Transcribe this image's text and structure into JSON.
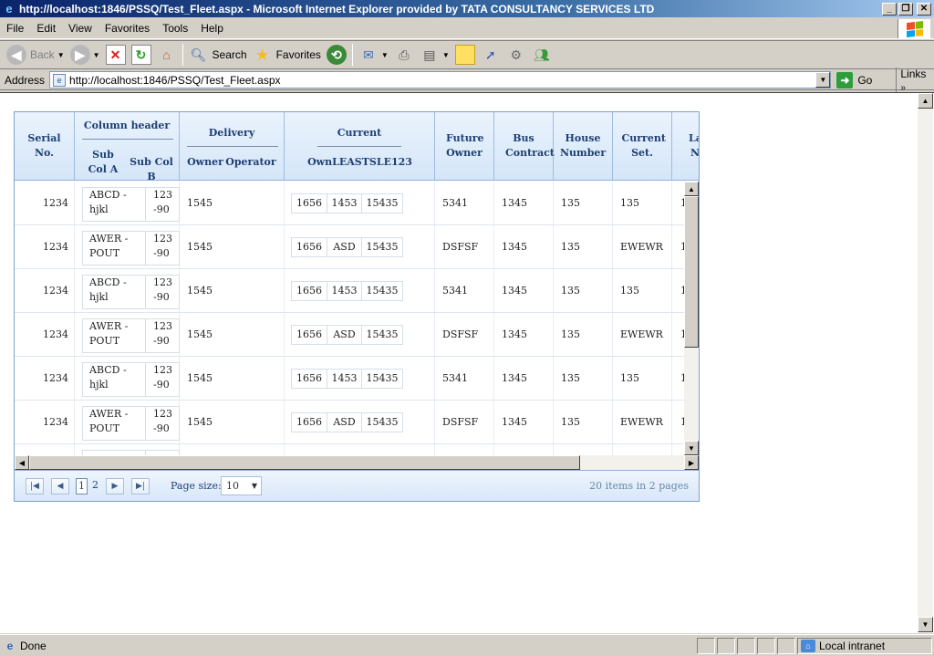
{
  "window": {
    "title": "http://localhost:1846/PSSQ/Test_Fleet.aspx - Microsoft Internet Explorer provided by TATA CONSULTANCY SERVICES LTD",
    "controls": [
      "minimize",
      "restore",
      "close"
    ]
  },
  "menu": [
    "File",
    "Edit",
    "View",
    "Favorites",
    "Tools",
    "Help"
  ],
  "toolbar": {
    "back": "Back",
    "search": "Search",
    "favorites": "Favorites"
  },
  "address": {
    "label": "Address",
    "url": "http://localhost:1846/PSSQ/Test_Fleet.aspx",
    "go": "Go",
    "links": "Links"
  },
  "grid": {
    "headers": {
      "serial": "Serial No.",
      "colgroup": "Column header",
      "subA": "Sub Col A",
      "subB": "Sub Col B",
      "delivery": "Delivery",
      "owner": "Owner",
      "operator": "Operator",
      "current": "Current",
      "currentSub": "OwnLEASTSLE123",
      "futureOwner": "Future Owner",
      "busContract": "Bus Contract",
      "houseNumber": "House Number",
      "currentSet": "Current Set.",
      "partial": "La N"
    },
    "rows": [
      {
        "serial": "1234",
        "a": "ABCD - hjkl",
        "b": "123-90",
        "owner": "1545",
        "c1": "1656",
        "c2": "1453",
        "c3": "15435",
        "future": "5341",
        "bus": "1345",
        "house": "135",
        "set": "135",
        "last": "1"
      },
      {
        "serial": "1234",
        "a": "AWER - POUT",
        "b": "123-90",
        "owner": "1545",
        "c1": "1656",
        "c2": "ASD",
        "c3": "15435",
        "future": "DSFSF",
        "bus": "1345",
        "house": "135",
        "set": "EWEWR",
        "last": "1"
      },
      {
        "serial": "1234",
        "a": "ABCD - hjkl",
        "b": "123-90",
        "owner": "1545",
        "c1": "1656",
        "c2": "1453",
        "c3": "15435",
        "future": "5341",
        "bus": "1345",
        "house": "135",
        "set": "135",
        "last": "1"
      },
      {
        "serial": "1234",
        "a": "AWER - POUT",
        "b": "123-90",
        "owner": "1545",
        "c1": "1656",
        "c2": "ASD",
        "c3": "15435",
        "future": "DSFSF",
        "bus": "1345",
        "house": "135",
        "set": "EWEWR",
        "last": "1"
      },
      {
        "serial": "1234",
        "a": "ABCD - hjkl",
        "b": "123-90",
        "owner": "1545",
        "c1": "1656",
        "c2": "1453",
        "c3": "15435",
        "future": "5341",
        "bus": "1345",
        "house": "135",
        "set": "135",
        "last": "1"
      },
      {
        "serial": "1234",
        "a": "AWER - POUT",
        "b": "123-90",
        "owner": "1545",
        "c1": "1656",
        "c2": "ASD",
        "c3": "15435",
        "future": "DSFSF",
        "bus": "1345",
        "house": "135",
        "set": "EWEWR",
        "last": "1"
      }
    ],
    "pager": {
      "pages": [
        "1",
        "2"
      ],
      "currentPage": "1",
      "pageSizeLabel": "Page size:",
      "pageSize": "10",
      "info": "20 items in 2 pages"
    }
  },
  "status": {
    "text": "Done",
    "zone": "Local intranet"
  },
  "colors": {
    "titleStart": "#0a246a",
    "gridHeader": "#d5e6f8",
    "headerText": "#1e3f74"
  }
}
